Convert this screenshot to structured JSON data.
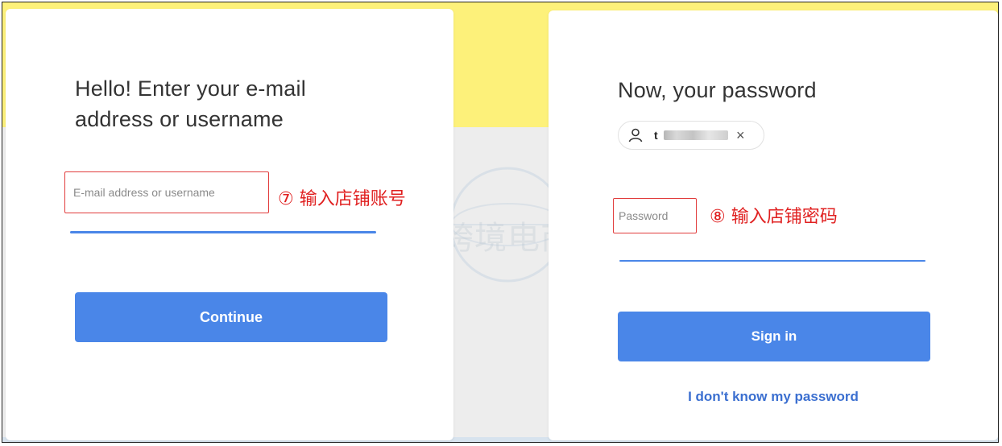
{
  "login_step1": {
    "title": "Hello! Enter your e-mail address or username",
    "input_placeholder": "E-mail address or username",
    "annotation": "⑦ 输入店铺账号",
    "continue_label": "Continue"
  },
  "login_step2": {
    "title": "Now, your password",
    "account_chip": {
      "username_prefix": "t",
      "icon": "user-icon",
      "remove_icon": "close-icon",
      "remove_symbol": "×"
    },
    "password_placeholder": "Password",
    "annotation": "⑧ 输入店铺密码",
    "signin_label": "Sign in",
    "forgot_link": "I don't know my password"
  },
  "watermark": {
    "text": "科灯跨境电商导航"
  },
  "colors": {
    "accent_blue": "#4a86e8",
    "annotation_red": "#e02020",
    "background_yellow": "#fdf17a",
    "background_gray": "#ededed"
  }
}
